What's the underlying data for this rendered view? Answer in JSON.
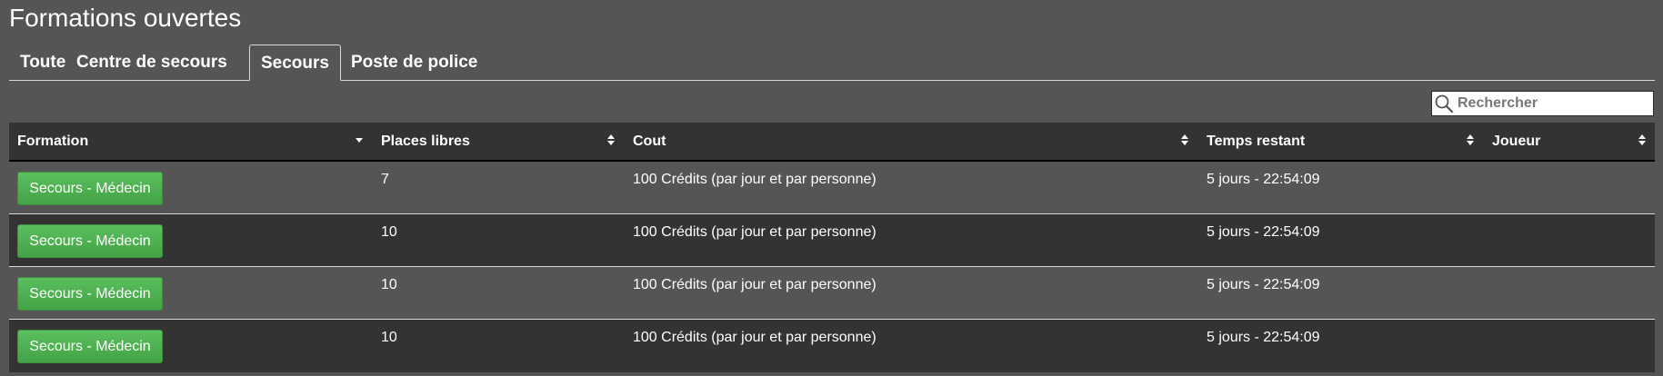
{
  "page": {
    "title": "Formations ouvertes"
  },
  "tabs": [
    {
      "label": "Toute",
      "active": false
    },
    {
      "label": "Centre de secours",
      "active": false
    },
    {
      "label": "Secours",
      "active": true
    },
    {
      "label": "Poste de police",
      "active": false
    }
  ],
  "search": {
    "placeholder": "Rechercher",
    "value": ""
  },
  "table": {
    "columns": [
      {
        "label": "Formation",
        "sort": "descending"
      },
      {
        "label": "Places libres",
        "sort": "none"
      },
      {
        "label": "Cout",
        "sort": "none"
      },
      {
        "label": "Temps restant",
        "sort": "none"
      },
      {
        "label": "Joueur",
        "sort": "none"
      }
    ],
    "rows": [
      {
        "formation": "Secours - Médecin",
        "places": "7",
        "cout": "100 Crédits (par jour et par personne)",
        "temps": "5 jours - 22:54:09",
        "joueur": ""
      },
      {
        "formation": "Secours - Médecin",
        "places": "10",
        "cout": "100 Crédits (par jour et par personne)",
        "temps": "5 jours - 22:54:09",
        "joueur": ""
      },
      {
        "formation": "Secours - Médecin",
        "places": "10",
        "cout": "100 Crédits (par jour et par personne)",
        "temps": "5 jours - 22:54:09",
        "joueur": ""
      },
      {
        "formation": "Secours - Médecin",
        "places": "10",
        "cout": "100 Crédits (par jour et par personne)",
        "temps": "5 jours - 22:54:09",
        "joueur": ""
      }
    ]
  },
  "colors": {
    "background": "#555555",
    "header_background": "#333333",
    "button_green": "#4cae4f",
    "row_dark": "#333333"
  },
  "icons": {
    "search": "magnifier-icon",
    "sort_desc": "caret-down-icon",
    "sort_both": "sort-both-icon"
  }
}
